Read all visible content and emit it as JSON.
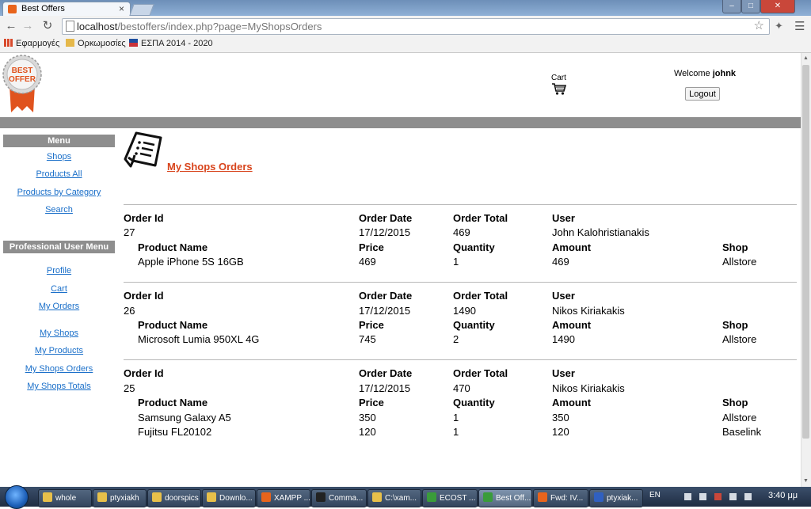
{
  "browser": {
    "tab_title": "Best Offers",
    "tab_close": "×",
    "url_host": "localhost",
    "url_path": "/bestoffers/index.php?page=MyShopsOrders",
    "window_buttons": [
      "–",
      "□",
      "✕"
    ],
    "bookmarks": [
      "Εφαρμογές",
      "Ορκωμοσίες",
      "ΕΣΠΑ 2014 - 2020"
    ]
  },
  "header": {
    "cart_label": "Cart",
    "welcome_prefix": "Welcome ",
    "username": "johnk",
    "logout_label": "Logout"
  },
  "sidebar": {
    "menu_title": "Menu",
    "menu_items": [
      "Shops",
      "Products All",
      "Products by Category",
      "Search"
    ],
    "pro_title": "Professional User Menu",
    "pro_items_group1": [
      "Profile",
      "Cart",
      "My Orders"
    ],
    "pro_items_group2": [
      "My Shops",
      "My Products",
      "My Shops Orders",
      "My Shops Totals"
    ]
  },
  "main": {
    "title": "My Shops Orders",
    "order_headers": [
      "Order Id",
      "Order Date",
      "Order Total",
      "User"
    ],
    "product_headers": [
      "Product Name",
      "Price",
      "Quantity",
      "Amount",
      "Shop"
    ],
    "orders": [
      {
        "id": "27",
        "date": "17/12/2015",
        "total": "469",
        "user": "John Kalohristianakis",
        "products": [
          {
            "name": "Apple iPhone 5S 16GB",
            "price": "469",
            "quantity": "1",
            "amount": "469",
            "shop": "Allstore"
          }
        ]
      },
      {
        "id": "26",
        "date": "17/12/2015",
        "total": "1490",
        "user": "Nikos Kiriakakis",
        "products": [
          {
            "name": "Microsoft Lumia 950XL 4G",
            "price": "745",
            "quantity": "2",
            "amount": "1490",
            "shop": "Allstore"
          }
        ]
      },
      {
        "id": "25",
        "date": "17/12/2015",
        "total": "470",
        "user": "Nikos Kiriakakis",
        "products": [
          {
            "name": "Samsung Galaxy A5",
            "price": "350",
            "quantity": "1",
            "amount": "350",
            "shop": "Allstore"
          },
          {
            "name": "Fujitsu FL20102",
            "price": "120",
            "quantity": "1",
            "amount": "120",
            "shop": "Baselink"
          }
        ]
      }
    ]
  },
  "taskbar": {
    "items": [
      {
        "label": "whole",
        "icon_color": "#e8c04a"
      },
      {
        "label": "ptyxiakh",
        "icon_color": "#e8c04a"
      },
      {
        "label": "doorspics",
        "icon_color": "#e8c04a"
      },
      {
        "label": "Downlo...",
        "icon_color": "#e8c04a"
      },
      {
        "label": "XAMPP ...",
        "icon_color": "#e8641c"
      },
      {
        "label": "Comma...",
        "icon_color": "#222222"
      },
      {
        "label": "C:\\xam...",
        "icon_color": "#e8c04a"
      },
      {
        "label": "ECOST ...",
        "icon_color": "#3a9c3a"
      },
      {
        "label": "Best Off...",
        "icon_color": "#3a9c3a"
      },
      {
        "label": "Fwd: IV...",
        "icon_color": "#e8641c"
      },
      {
        "label": "ptyxiak...",
        "icon_color": "#3060c0"
      }
    ],
    "language": "EN",
    "clock": "3:40 μμ"
  }
}
